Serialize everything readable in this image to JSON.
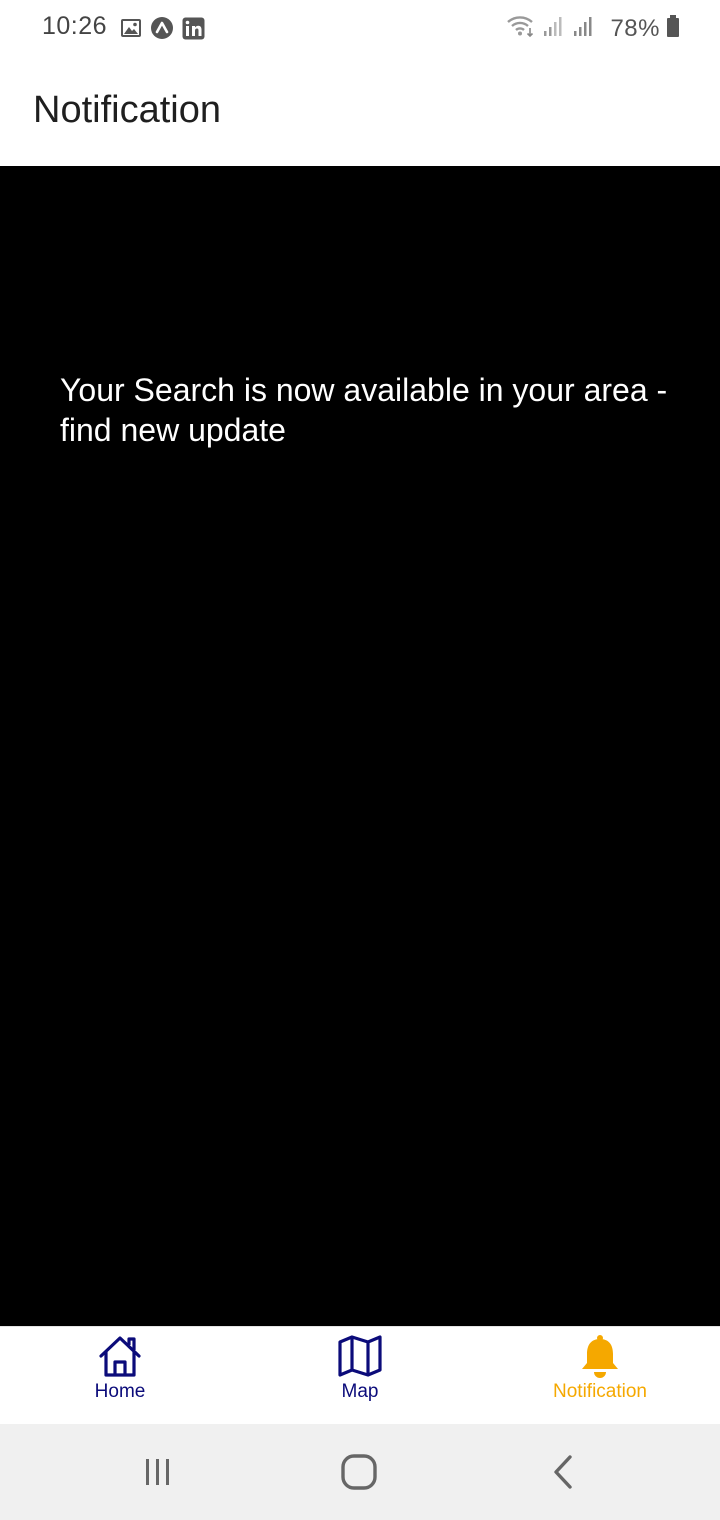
{
  "status_bar": {
    "time": "10:26",
    "battery": "78%",
    "icons": [
      "image-icon",
      "app-icon",
      "linkedin-icon",
      "wifi-icon",
      "signal-icon",
      "signal-icon",
      "battery-icon"
    ]
  },
  "header": {
    "title": "Notification"
  },
  "main": {
    "notification_text": "Your Search is now available in your area - find new update"
  },
  "tab_bar": {
    "tabs": [
      {
        "label": "Home",
        "icon": "home-icon",
        "active": false
      },
      {
        "label": "Map",
        "icon": "map-icon",
        "active": false
      },
      {
        "label": "Notification",
        "icon": "bell-icon",
        "active": true
      }
    ],
    "colors": {
      "inactive": "#0b0b7a",
      "active": "#f5a800"
    }
  },
  "system_nav": {
    "buttons": [
      "recents-icon",
      "home-button-icon",
      "back-icon"
    ]
  }
}
